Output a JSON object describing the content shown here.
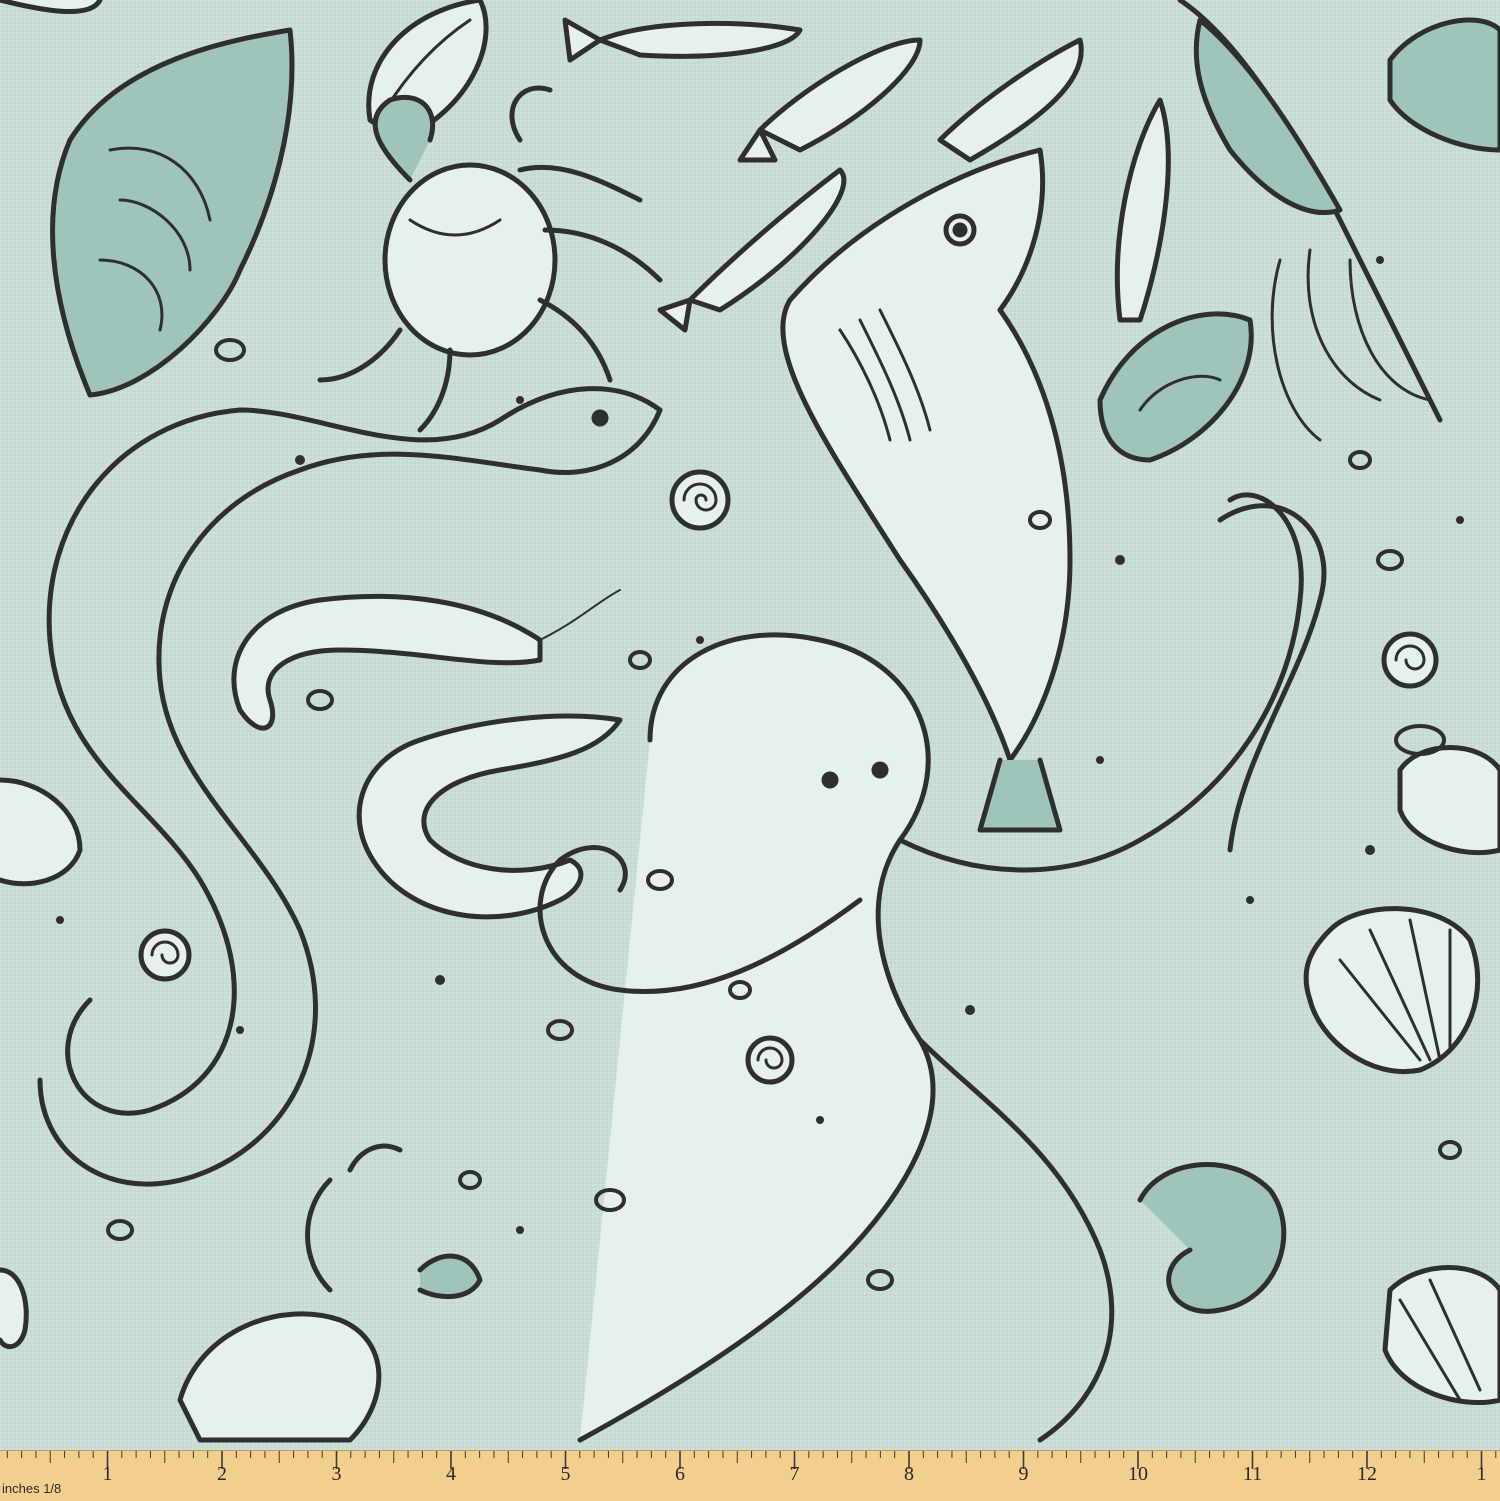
{
  "scene": {
    "subject": "seafood-pattern-fabric",
    "background_color": "#c9ddd7",
    "ink_color": "#2f2f2f",
    "shade_color": "#8fb6ae",
    "highlight_color": "#e6f0ec"
  },
  "ruler": {
    "unit_label": "inches 1/8",
    "numbers": [
      "1",
      "2",
      "3",
      "4",
      "5",
      "6",
      "7",
      "8",
      "9",
      "10",
      "11",
      "12",
      "1"
    ],
    "color": "#f3cf8e"
  }
}
